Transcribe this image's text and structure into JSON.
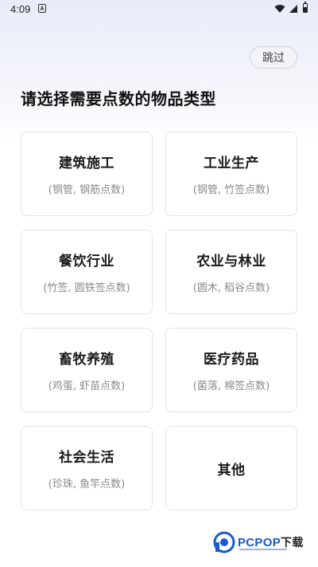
{
  "status_bar": {
    "time": "4:09"
  },
  "header": {
    "skip_label": "跳过",
    "title": "请选择需要点数的物品类型"
  },
  "categories": [
    {
      "title": "建筑施工",
      "subtitle": "(钢管, 钢筋点数)"
    },
    {
      "title": "工业生产",
      "subtitle": "(钢管, 竹签点数)"
    },
    {
      "title": "餐饮行业",
      "subtitle": "(竹签, 圆铁签点数)"
    },
    {
      "title": "农业与林业",
      "subtitle": "(圆木, 稻谷点数)"
    },
    {
      "title": "畜牧养殖",
      "subtitle": "(鸡蛋, 虾苗点数)"
    },
    {
      "title": "医疗药品",
      "subtitle": "(菌落, 棉签点数)"
    },
    {
      "title": "社会生活",
      "subtitle": "(珍珠, 鱼竿点数)"
    },
    {
      "title": "其他",
      "subtitle": ""
    }
  ],
  "watermark": {
    "brand": "PCPOP",
    "suffix": "下载"
  }
}
